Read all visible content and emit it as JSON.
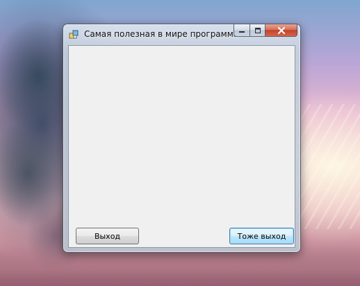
{
  "window": {
    "title": "Самая полезная в мире программа",
    "icon": "app-icon",
    "caption_buttons": {
      "minimize_icon": "minimize-icon",
      "maximize_icon": "maximize-icon",
      "close_icon": "close-icon"
    }
  },
  "buttons": {
    "exit_label": "Выход",
    "exit2_label": "Тоже выход"
  },
  "colors": {
    "close_button": "#c2432a",
    "client_background": "#f0f0f0",
    "focused_button_border": "#3c7fb1"
  }
}
